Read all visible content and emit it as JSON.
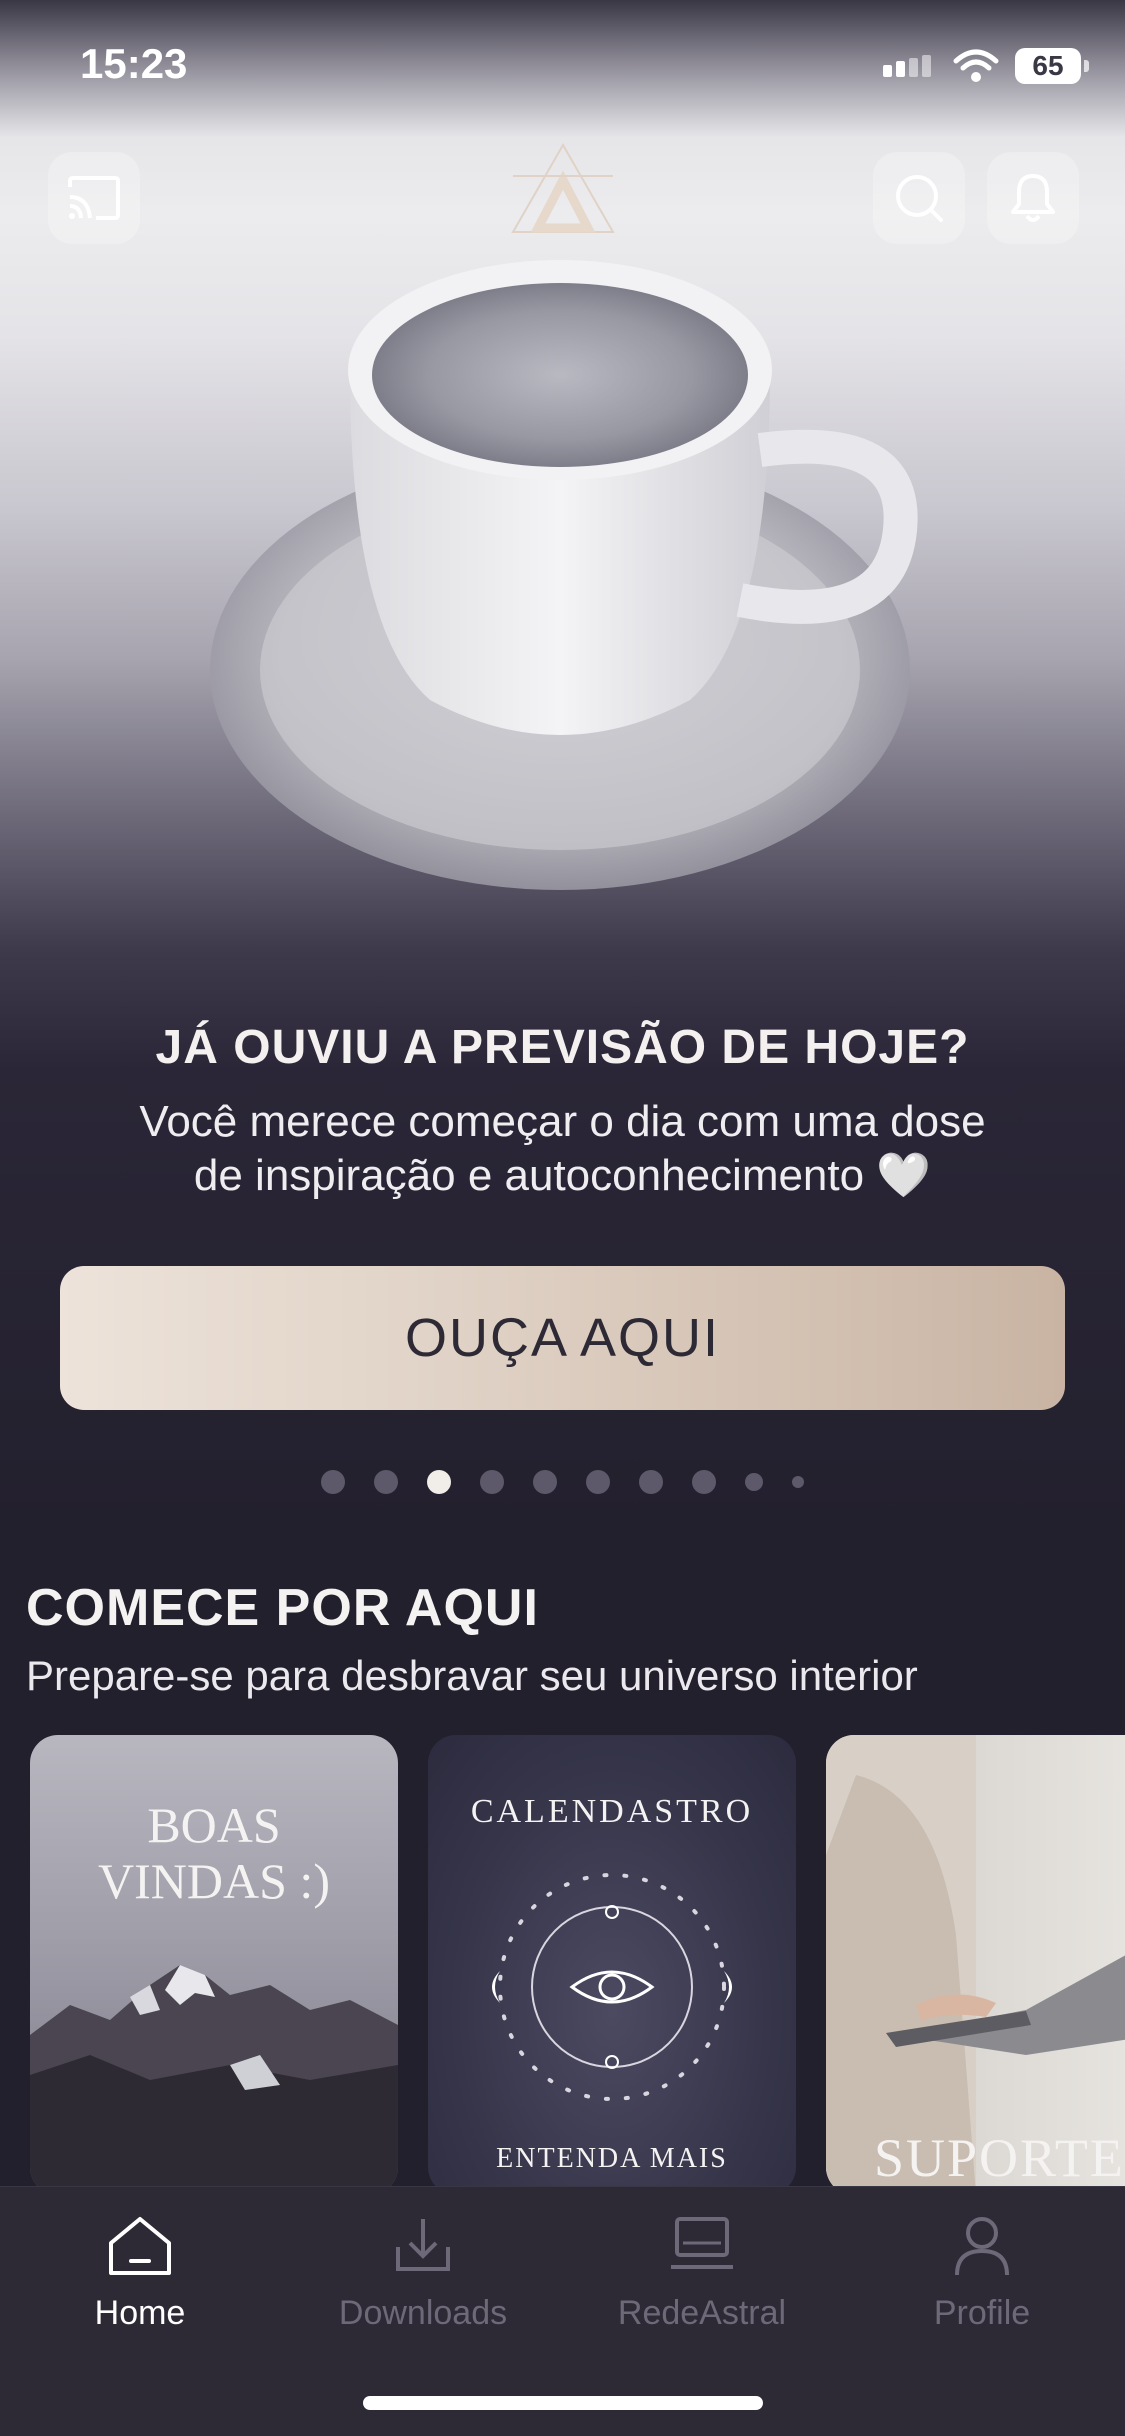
{
  "status_bar": {
    "time": "15:23",
    "battery": "65"
  },
  "hero": {
    "title": "JÁ OUVIU A PREVISÃO DE HOJE?",
    "subtitle_line1": "Você merece começar o dia com uma dose",
    "subtitle_line2": "de inspiração e autoconhecimento 🤍",
    "cta_label": "OUÇA AQUI",
    "carousel_total": 10,
    "carousel_active": 3
  },
  "section": {
    "title": "COMECE POR AQUI",
    "subtitle": "Prepare-se para desbravar seu universo interior"
  },
  "cards": [
    {
      "line1": "BOAS",
      "line2": "VINDAS :)"
    },
    {
      "title": "CALENDASTRO",
      "footer": "ENTENDA MAIS"
    },
    {
      "title": "SUPORTE"
    }
  ],
  "tabs": [
    {
      "label": "Home",
      "icon": "home-icon",
      "active": true
    },
    {
      "label": "Downloads",
      "icon": "download-icon",
      "active": false
    },
    {
      "label": "RedeAstral",
      "icon": "laptop-icon",
      "active": false
    },
    {
      "label": "Profile",
      "icon": "profile-icon",
      "active": false
    }
  ],
  "colors": {
    "background": "#23202e",
    "cta_gradient_start": "#ede3da",
    "cta_gradient_end": "#c9b4a3",
    "tab_active": "#ffffff",
    "tab_inactive": "#6d6978"
  }
}
